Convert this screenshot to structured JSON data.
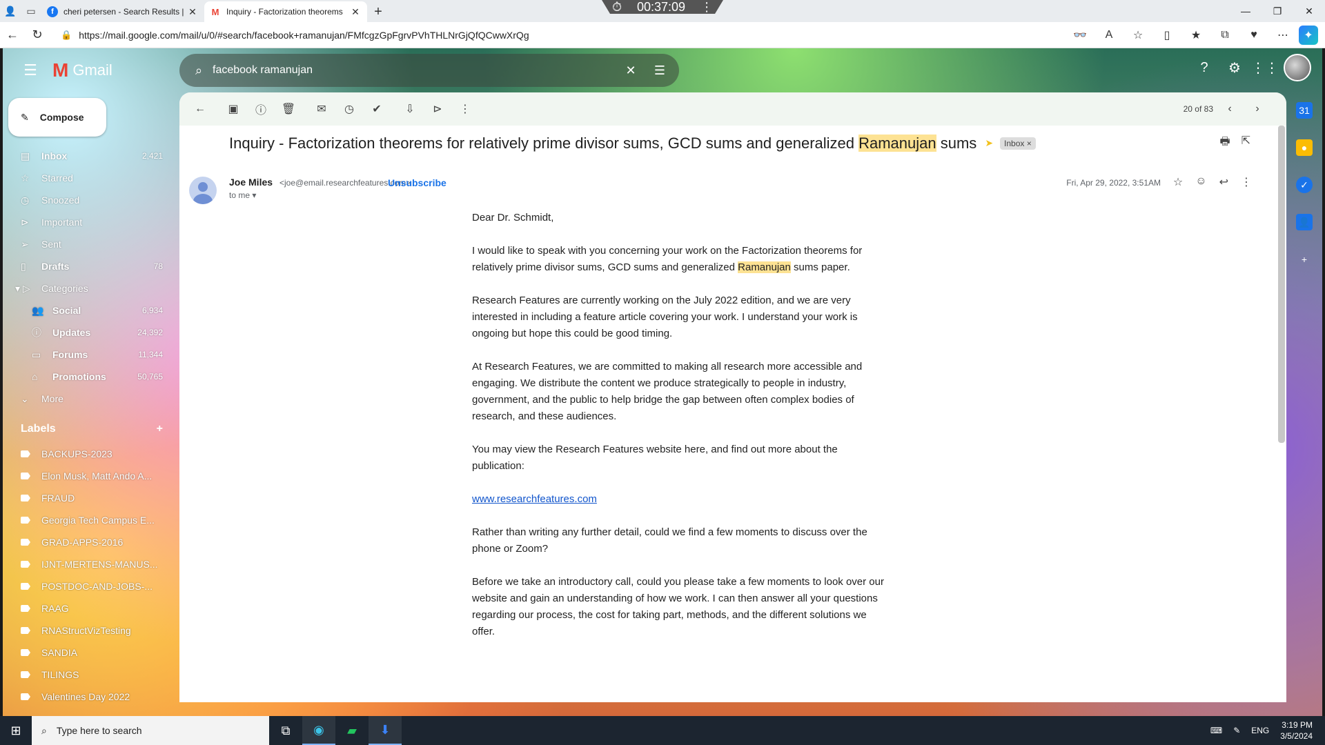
{
  "timer": "00:37:09",
  "tabs": [
    {
      "title": "cheri petersen - Search Results |",
      "favicon": "facebook-icon",
      "active": false
    },
    {
      "title": "Inquiry - Factorization theorems",
      "favicon": "gmail-icon",
      "active": true
    }
  ],
  "address": {
    "url": "https://mail.google.com/mail/u/0/#search/facebook+ramanujan/FMfcgzGpFgrvPVhTHLNrGjQfQCwwXrQg"
  },
  "gmail": {
    "logo_text": "Gmail",
    "search_value": "facebook ramanujan",
    "compose_label": "Compose"
  },
  "sidebar": {
    "items": [
      {
        "label": "Inbox",
        "count": "2,421",
        "icon": "inbox-icon"
      },
      {
        "label": "Starred",
        "count": "",
        "icon": "star-icon"
      },
      {
        "label": "Snoozed",
        "count": "",
        "icon": "clock-icon"
      },
      {
        "label": "Important",
        "count": "",
        "icon": "important-icon"
      },
      {
        "label": "Sent",
        "count": "",
        "icon": "send-icon"
      },
      {
        "label": "Drafts",
        "count": "78",
        "icon": "draft-icon"
      },
      {
        "label": "Categories",
        "count": "",
        "icon": "label-icon"
      },
      {
        "label": "Social",
        "count": "6,934",
        "icon": "people-icon"
      },
      {
        "label": "Updates",
        "count": "24,392",
        "icon": "info-icon"
      },
      {
        "label": "Forums",
        "count": "11,344",
        "icon": "forum-icon"
      },
      {
        "label": "Promotions",
        "count": "50,765",
        "icon": "tag-icon"
      },
      {
        "label": "More",
        "count": "",
        "icon": "chevron-down-icon"
      }
    ],
    "labels_heading": "Labels",
    "labels": [
      "BACKUPS-2023",
      "Elon Musk, Matt Ando A...",
      "FRAUD",
      "Georgia Tech Campus E...",
      "GRAD-APPS-2016",
      "IJNT-MERTENS-MANUS...",
      "POSTDOC-AND-JOBS-...",
      "RAAG",
      "RNAStructVizTesting",
      "SANDIA",
      "TILINGS",
      "Valentines Day 2022"
    ]
  },
  "toolbar": {
    "pager": "20 of 83"
  },
  "message": {
    "subject_before": "Inquiry - Factorization theorems for relatively prime divisor sums, GCD sums and generalized ",
    "subject_highlight": "Ramanujan",
    "subject_after": " sums",
    "inbox_chip": "Inbox",
    "sender_name": "Joe Miles",
    "sender_email": "<joe@email.researchfeatures.com>",
    "unsubscribe": "Unsubscribe",
    "to": "to me",
    "date": "Fri, Apr 29, 2022, 3:51AM",
    "greeting": "Dear Dr. Schmidt,",
    "p1_before": "I would like to speak with you concerning your work on the Factorization theorems for relatively prime divisor sums, GCD sums and generalized ",
    "p1_highlight": "Ramanujan",
    "p1_after": " sums paper.",
    "p2": "Research Features are currently working on the July 2022 edition, and we are very interested in including a feature article covering your work. I understand your work is ongoing but hope this could be good timing.",
    "p3": "At Research Features, we are committed to making all research more accessible and engaging. We distribute the content we produce strategically to people in industry, government, and the public to help bridge the gap between often complex bodies of research, and these audiences.",
    "p4": "You may view the Research Features website here, and find out more about the publication:",
    "link": "www.researchfeatures.com",
    "p5": "Rather than writing any further detail, could we find a few moments to discuss over the phone or Zoom?",
    "p6": "Before we take an introductory call, could you please take a few moments to look over our website and gain an understanding of how we work. I can then answer all your questions regarding our process, the cost for taking part, methods, and the different solutions we offer."
  },
  "taskbar": {
    "search_placeholder": "Type here to search",
    "lang": "ENG",
    "time": "3:19 PM",
    "date": "3/5/2024"
  }
}
